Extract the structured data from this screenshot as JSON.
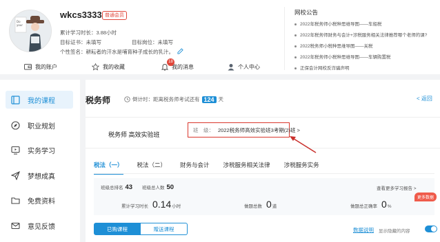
{
  "profile": {
    "username": "wkcs3333",
    "member_badge": "普通会员",
    "study_time": "累计学习时长：3.88小时",
    "target_cert": "目标证书：未填写",
    "target_job": "目标岗位：未填写",
    "signature": "个性签名：耕耘者的汗水是哺育种子成长的乳汁。"
  },
  "topnav": [
    {
      "label": "我的账户",
      "icon": "wallet-icon"
    },
    {
      "label": "我的收藏",
      "icon": "star-icon"
    },
    {
      "label": "我的消息",
      "icon": "bell-icon"
    },
    {
      "label": "个人中心",
      "icon": "user-icon"
    }
  ],
  "message_count": "18",
  "notices": {
    "title": "网校公告",
    "items": [
      "2022年税务师小税种思维导图——车船税",
      "2022年税务师财务与会计+涉税服务相关法律推荐哪个老师的课?",
      "2022税务师小税种思维导图——关税",
      "2022年税务师小税种思维导图——车辆购置税",
      "正保会计网校反诈骗声明"
    ]
  },
  "sidebar": [
    {
      "label": "我的课程",
      "icon": "book-icon",
      "active": true
    },
    {
      "label": "职业规划",
      "icon": "compass-icon",
      "active": false
    },
    {
      "label": "实务学习",
      "icon": "monitor-icon",
      "active": false
    },
    {
      "label": "梦想成真",
      "icon": "paper-plane-icon",
      "active": false
    },
    {
      "label": "免费资料",
      "icon": "folder-icon",
      "active": false
    },
    {
      "label": "意见反馈",
      "icon": "mail-icon",
      "active": false
    }
  ],
  "course": {
    "title": "税务师",
    "countdown_prefix": "倒计时：距离税务师考试还有",
    "countdown_days": "124",
    "countdown_unit": "天",
    "back": "< 返回"
  },
  "class_card": {
    "name": "税务师 高效实验班",
    "class_label": "班　级：",
    "class_value": "2022税务师高效实验班3考期(2)班 >"
  },
  "tabs": [
    "税法（一）",
    "税法（二）",
    "财务与会计",
    "涉税服务相关法律",
    "涉税服务实务"
  ],
  "stats": {
    "class_rank_label": "班级总排名",
    "class_rank": "43",
    "class_total_label": "班级总人数",
    "class_total": "50",
    "report_link": "查看更多学习报告 >",
    "study_time_label": "累计学习时长",
    "study_time_value": "0.14",
    "study_time_unit": "小时",
    "questions_label": "做题总数",
    "questions_value": "0",
    "questions_unit": "道",
    "accuracy_label": "做题总正确率",
    "accuracy_value": "0",
    "accuracy_unit": "%",
    "more_tag": "更多数据"
  },
  "course_tabs": {
    "purchased": "已购课程",
    "elective": "赠送课程"
  },
  "footer": {
    "link": "数据说明",
    "hide_label": "显示隐藏的内容"
  }
}
